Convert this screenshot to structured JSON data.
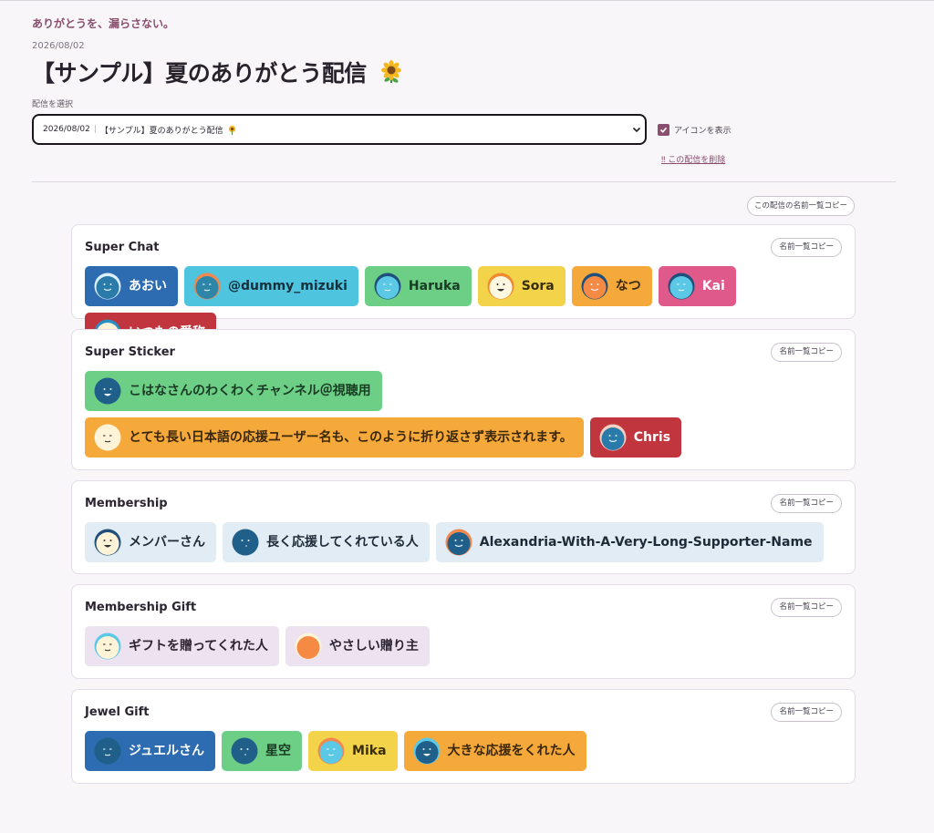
{
  "app": {
    "tagline": "ありがとうを、漏らさない。",
    "date": "2026/08/02",
    "title": "【サンプル】夏のありがとう配信"
  },
  "selector": {
    "label": "配信を選択",
    "selected_date": "2026/08/02",
    "selected_title": "【サンプル】夏のありがとう配信"
  },
  "options": {
    "show_icons_label": "アイコンを表示",
    "show_icons_checked": true,
    "delete_label": "この配信を削除"
  },
  "copy_all_label": "この配信の名前一覧コピー",
  "copy_label": "名前一覧コピー",
  "colors": {
    "accent": "#8a4e6e",
    "blue": "#2d6cb0",
    "cyan": "#4fc4de",
    "green": "#6ccf85",
    "yellow": "#f3d34a",
    "orange": "#f6a93b",
    "pink": "#df5a8a",
    "red": "#c1353f",
    "light_blue": "#e1ecf5",
    "lavender": "#ece2f0"
  },
  "sections": [
    {
      "title": "Super Chat",
      "items": [
        {
          "name": "あおい",
          "bg": "#2d6cb0",
          "fg": "#ffffff",
          "face": "#2a7aaa",
          "hair": "#dcefff",
          "mood": "smile"
        },
        {
          "name": "@dummy_mizuki",
          "bg": "#4fc4de",
          "fg": "#17303d",
          "face": "#2d86a8",
          "hair": "#f08850",
          "mood": "wink"
        },
        {
          "name": "Haruka",
          "bg": "#6ccf85",
          "fg": "#1a3a24",
          "face": "#5bc9e6",
          "hair": "#1f4f7a",
          "mood": "wink"
        },
        {
          "name": "Sora",
          "bg": "#f3d34a",
          "fg": "#3a2e08",
          "face": "#fff8e0",
          "hair": "#f08a30",
          "mood": "open"
        },
        {
          "name": "なつ",
          "bg": "#f6a93b",
          "fg": "#3a2608",
          "face": "#f58a45",
          "hair": "#1f4f7a",
          "mood": "smile"
        },
        {
          "name": "Kai",
          "bg": "#df5a8a",
          "fg": "#ffffff",
          "face": "#5bc9e6",
          "hair": "#1f4f7a",
          "mood": "wink"
        },
        {
          "name": "いつもの愛称",
          "bg": "#c1353f",
          "fg": "#ffffff",
          "face": "#fff3d8",
          "hair": "#2a8ec0",
          "mood": "smile"
        }
      ]
    },
    {
      "title": "Super Sticker",
      "items": [
        {
          "name": "こはなさんのわくわくチャンネル＠視聴用",
          "bg": "#6ccf85",
          "fg": "#1a3a24",
          "face": "#1f5f8a",
          "hair": "#1f5f8a",
          "mood": "open"
        },
        {
          "name": "とても長い日本語の応援ユーザー名も、このように折り返さず表示されます。",
          "bg": "#f6a93b",
          "fg": "#3a2608",
          "face": "#fff3d8",
          "hair": "#fff3d8",
          "mood": "wink"
        },
        {
          "name": "Chris",
          "bg": "#c1353f",
          "fg": "#ffffff",
          "face": "#2a7aaa",
          "hair": "#f4d0c0",
          "mood": "smile"
        }
      ]
    },
    {
      "title": "Membership",
      "items": [
        {
          "name": "メンバーさん",
          "bg": "#e1ecf5",
          "fg": "#1e2a36",
          "face": "#fff3d8",
          "hair": "#1f4f7a",
          "mood": "open"
        },
        {
          "name": "長く応援してくれている人",
          "bg": "#e1ecf5",
          "fg": "#1e2a36",
          "face": "#1f5f8a",
          "hair": "#1f5f8a",
          "mood": "dot"
        },
        {
          "name": "Alexandria-With-A-Very-Long-Supporter-Name",
          "bg": "#e1ecf5",
          "fg": "#1e2a36",
          "face": "#1f5f8a",
          "hair": "#f08850",
          "mood": "smile"
        }
      ]
    },
    {
      "title": "Membership Gift",
      "items": [
        {
          "name": "ギフトを贈ってくれた人",
          "bg": "#ece2f0",
          "fg": "#2c2433",
          "face": "#fff3d8",
          "hair": "#5bc9e6",
          "mood": "wink"
        },
        {
          "name": "やさしい贈り主",
          "bg": "#ece2f0",
          "fg": "#2c2433",
          "face": "#f58a45",
          "hair": "#fff3d8",
          "mood": "none"
        }
      ]
    },
    {
      "title": "Jewel Gift",
      "items": [
        {
          "name": "ジュエルさん",
          "bg": "#2d6cb0",
          "fg": "#ffffff",
          "face": "#1f5f8a",
          "hair": "#1f5f8a",
          "mood": "wink"
        },
        {
          "name": "星空",
          "bg": "#6ccf85",
          "fg": "#1a3a24",
          "face": "#1f5f8a",
          "hair": "#1f5f8a",
          "mood": "dot"
        },
        {
          "name": "Mika",
          "bg": "#f3d34a",
          "fg": "#3a2e08",
          "face": "#5bc9e6",
          "hair": "#f08850",
          "mood": "wink"
        },
        {
          "name": "大きな応援をくれた人",
          "bg": "#f6a93b",
          "fg": "#3a2608",
          "face": "#1f5f8a",
          "hair": "#5bc9e6",
          "mood": "open"
        }
      ]
    }
  ]
}
